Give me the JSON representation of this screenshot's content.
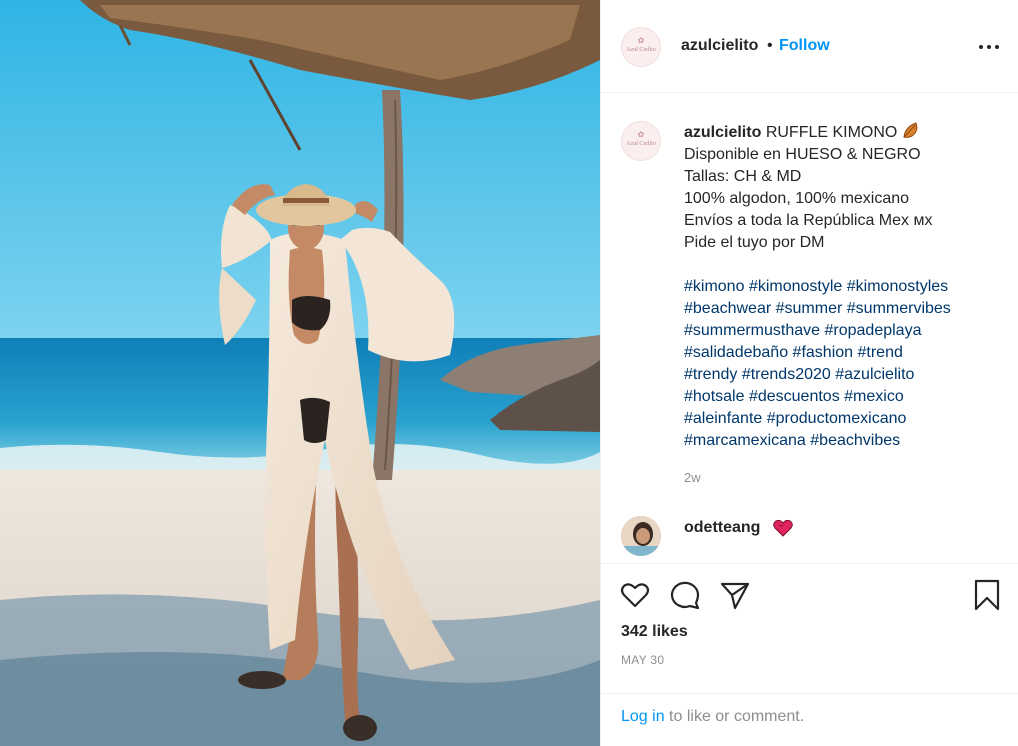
{
  "post": {
    "username": "azulcielito",
    "separator": "•",
    "follow_label": "Follow",
    "avatar_text": "Azul Cielito",
    "avatar_mark": "✿"
  },
  "caption": {
    "username": "azulcielito",
    "lines": [
      "RUFFLE KIMONO",
      "Disponible en HUESO & NEGRO",
      "Tallas: CH & MD",
      "100% algodon, 100% mexicano",
      "Envíos a toda la República Mex ᴍx",
      "Pide el tuyo por DM"
    ],
    "hashtags": [
      [
        "#kimono",
        "#kimonostyle",
        "#kimonostyles"
      ],
      [
        "#beachwear",
        "#summer",
        "#summervibes"
      ],
      [
        "#summermusthave",
        "#ropadeplaya"
      ],
      [
        "#salidadebaño",
        "#fashion",
        "#trend"
      ],
      [
        "#trendy",
        "#trends2020",
        "#azulcielito"
      ],
      [
        "#hotsale",
        "#descuentos",
        "#mexico"
      ],
      [
        "#aleinfante",
        "#productomexicano"
      ],
      [
        "#marcamexicana",
        "#beachvibes"
      ]
    ],
    "time_ago": "2w"
  },
  "comment": {
    "username": "odetteang"
  },
  "stats": {
    "likes": "342 likes",
    "date": "MAY 30"
  },
  "footer": {
    "login_link": "Log in",
    "login_rest": " to like or comment."
  },
  "icons": {
    "like": "heart-outline-icon",
    "comment": "speech-bubble-icon",
    "share": "paper-plane-icon",
    "save": "bookmark-icon",
    "more": "ellipsis-icon"
  },
  "colors": {
    "link_blue": "#0095f6",
    "hashtag_blue": "#00376b",
    "muted_gray": "#8e8e8e",
    "text": "#262626"
  }
}
